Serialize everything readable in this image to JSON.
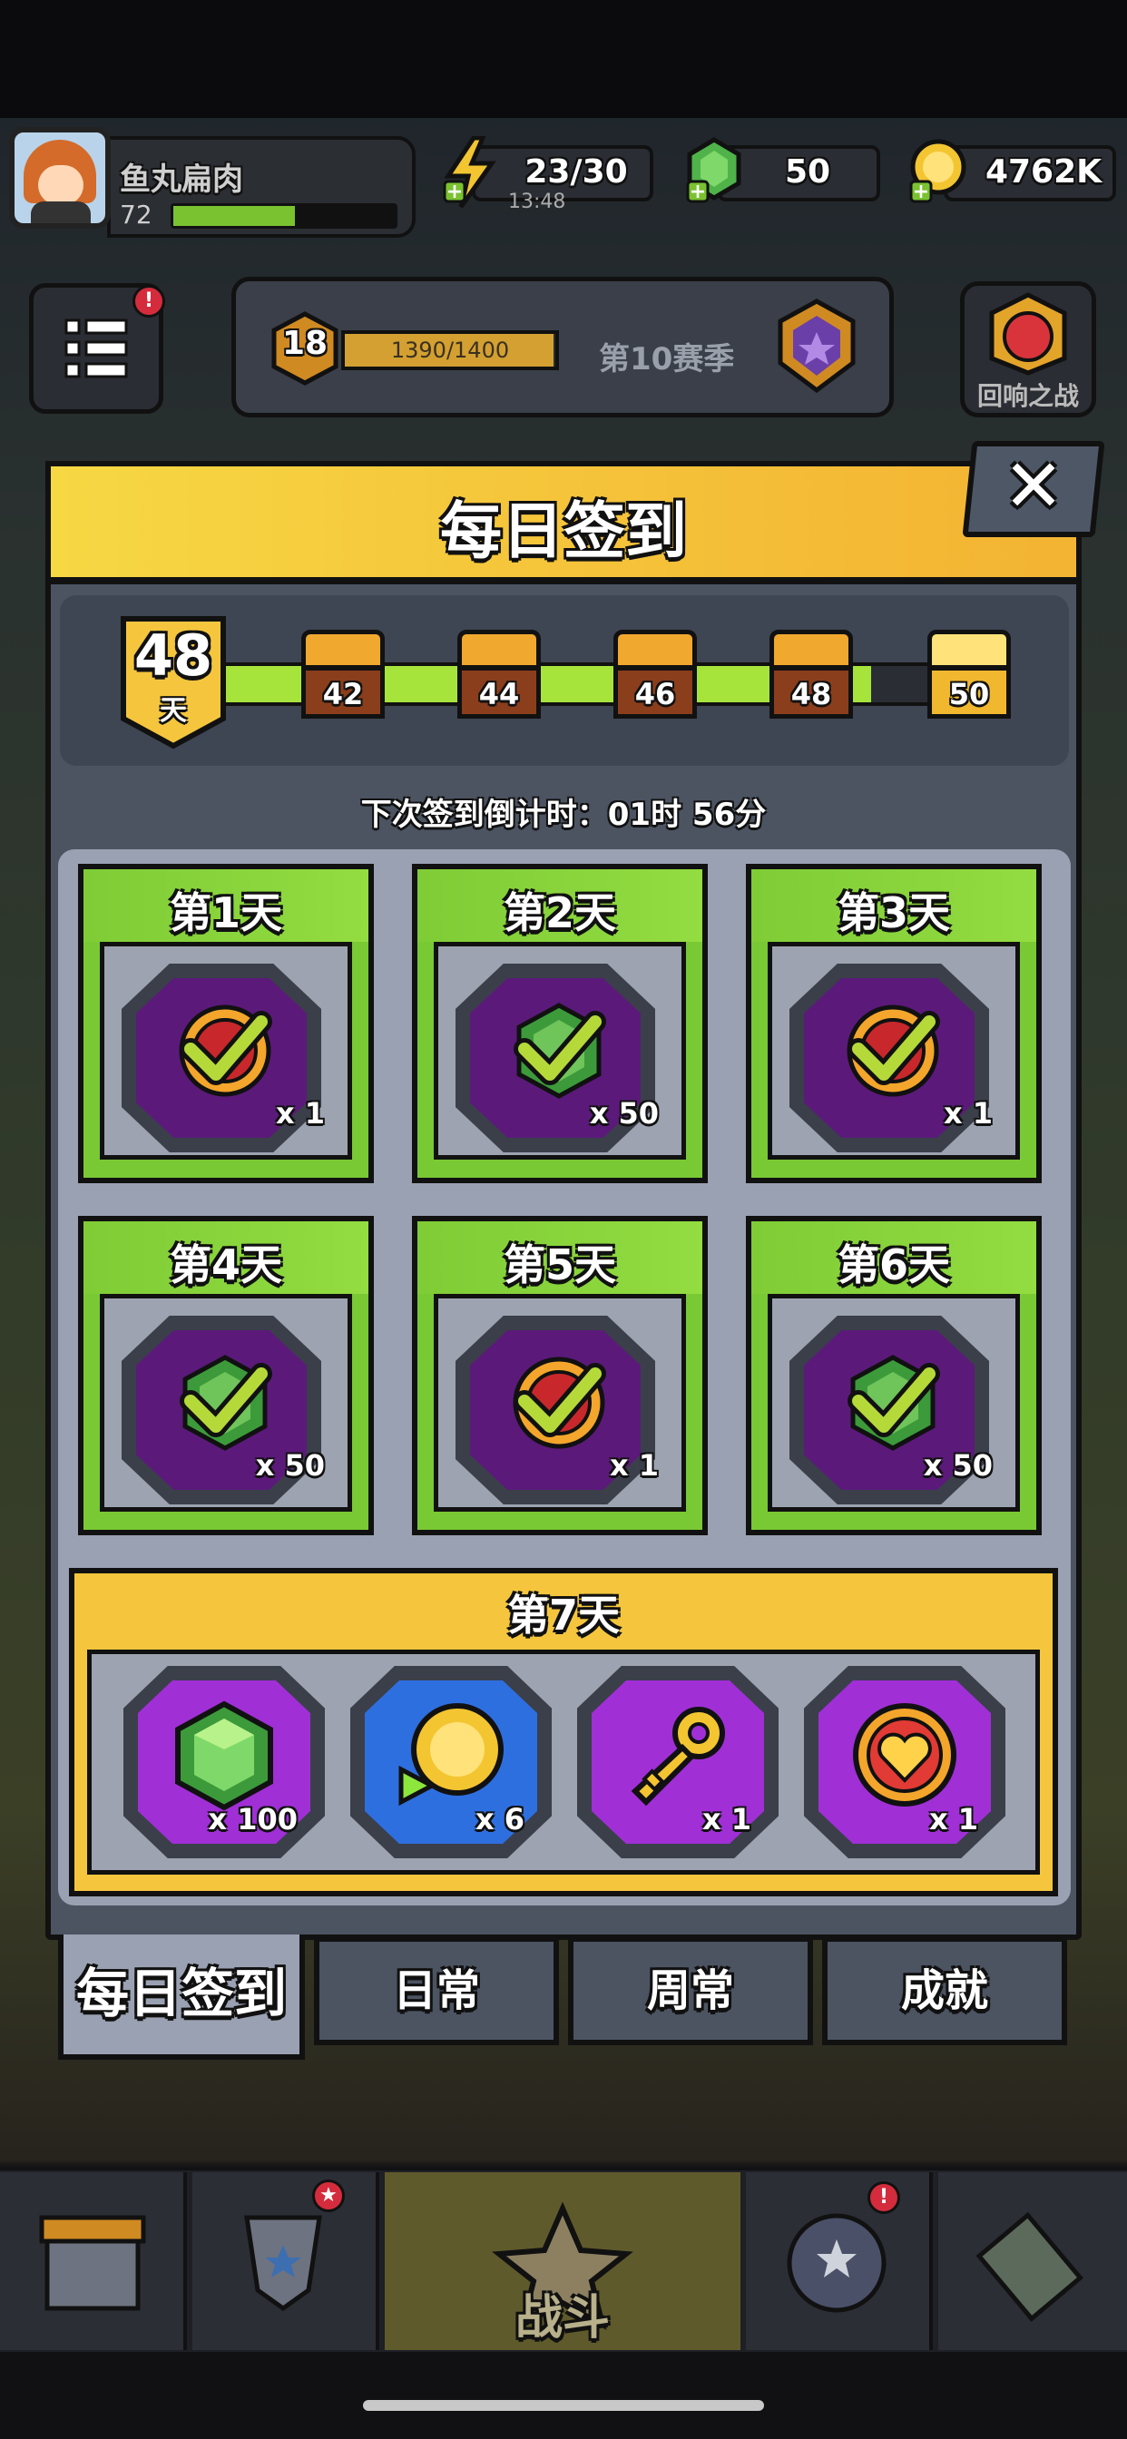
{
  "player": {
    "name": "鱼丸扁肉",
    "level": "72",
    "xp_fraction": 0.55
  },
  "resources": {
    "energy": "23/30",
    "energy_timer": "13:48",
    "gems": "50",
    "coins": "4762K"
  },
  "season_panel": {
    "rank": "18",
    "progress": "1390/1400",
    "progress_fraction": 0.99,
    "season_label": "第10赛季"
  },
  "echo_battle_label": "回响之战",
  "modal": {
    "title": "每日签到",
    "close_glyph": "✕",
    "streak_days": "48",
    "streak_unit": "天",
    "streak_fill_fraction": 0.86,
    "milestones": [
      "42",
      "44",
      "46",
      "48",
      "50"
    ],
    "countdown": "下次签到倒计时：01时 56分"
  },
  "days": [
    {
      "title": "第1天",
      "reward": "coin-heart",
      "qty": "x 1",
      "claimed": true
    },
    {
      "title": "第2天",
      "reward": "gem",
      "qty": "x 50",
      "claimed": true
    },
    {
      "title": "第3天",
      "reward": "coin-heart",
      "qty": "x 1",
      "claimed": true
    },
    {
      "title": "第4天",
      "reward": "gem",
      "qty": "x 50",
      "claimed": true
    },
    {
      "title": "第5天",
      "reward": "coin-heart",
      "qty": "x 1",
      "claimed": true
    },
    {
      "title": "第6天",
      "reward": "gem",
      "qty": "x 50",
      "claimed": true
    }
  ],
  "day7": {
    "title": "第7天",
    "rewards": [
      {
        "icon": "gem-icon",
        "qty": "x 100"
      },
      {
        "icon": "fast-coin-icon",
        "qty": "x 6"
      },
      {
        "icon": "key-icon",
        "qty": "x 1"
      },
      {
        "icon": "heart-coin-icon",
        "qty": "x 1"
      }
    ]
  },
  "tabs": [
    "每日签到",
    "日常",
    "周常",
    "成就"
  ],
  "nav": {
    "battle_label": "战斗"
  },
  "colors": {
    "header_yellow": "#f5c43a",
    "day_green": "#79c934",
    "reward_purple": "#a02fd6",
    "progress_green": "#a6e43c",
    "alert_red": "#d42c3c"
  }
}
